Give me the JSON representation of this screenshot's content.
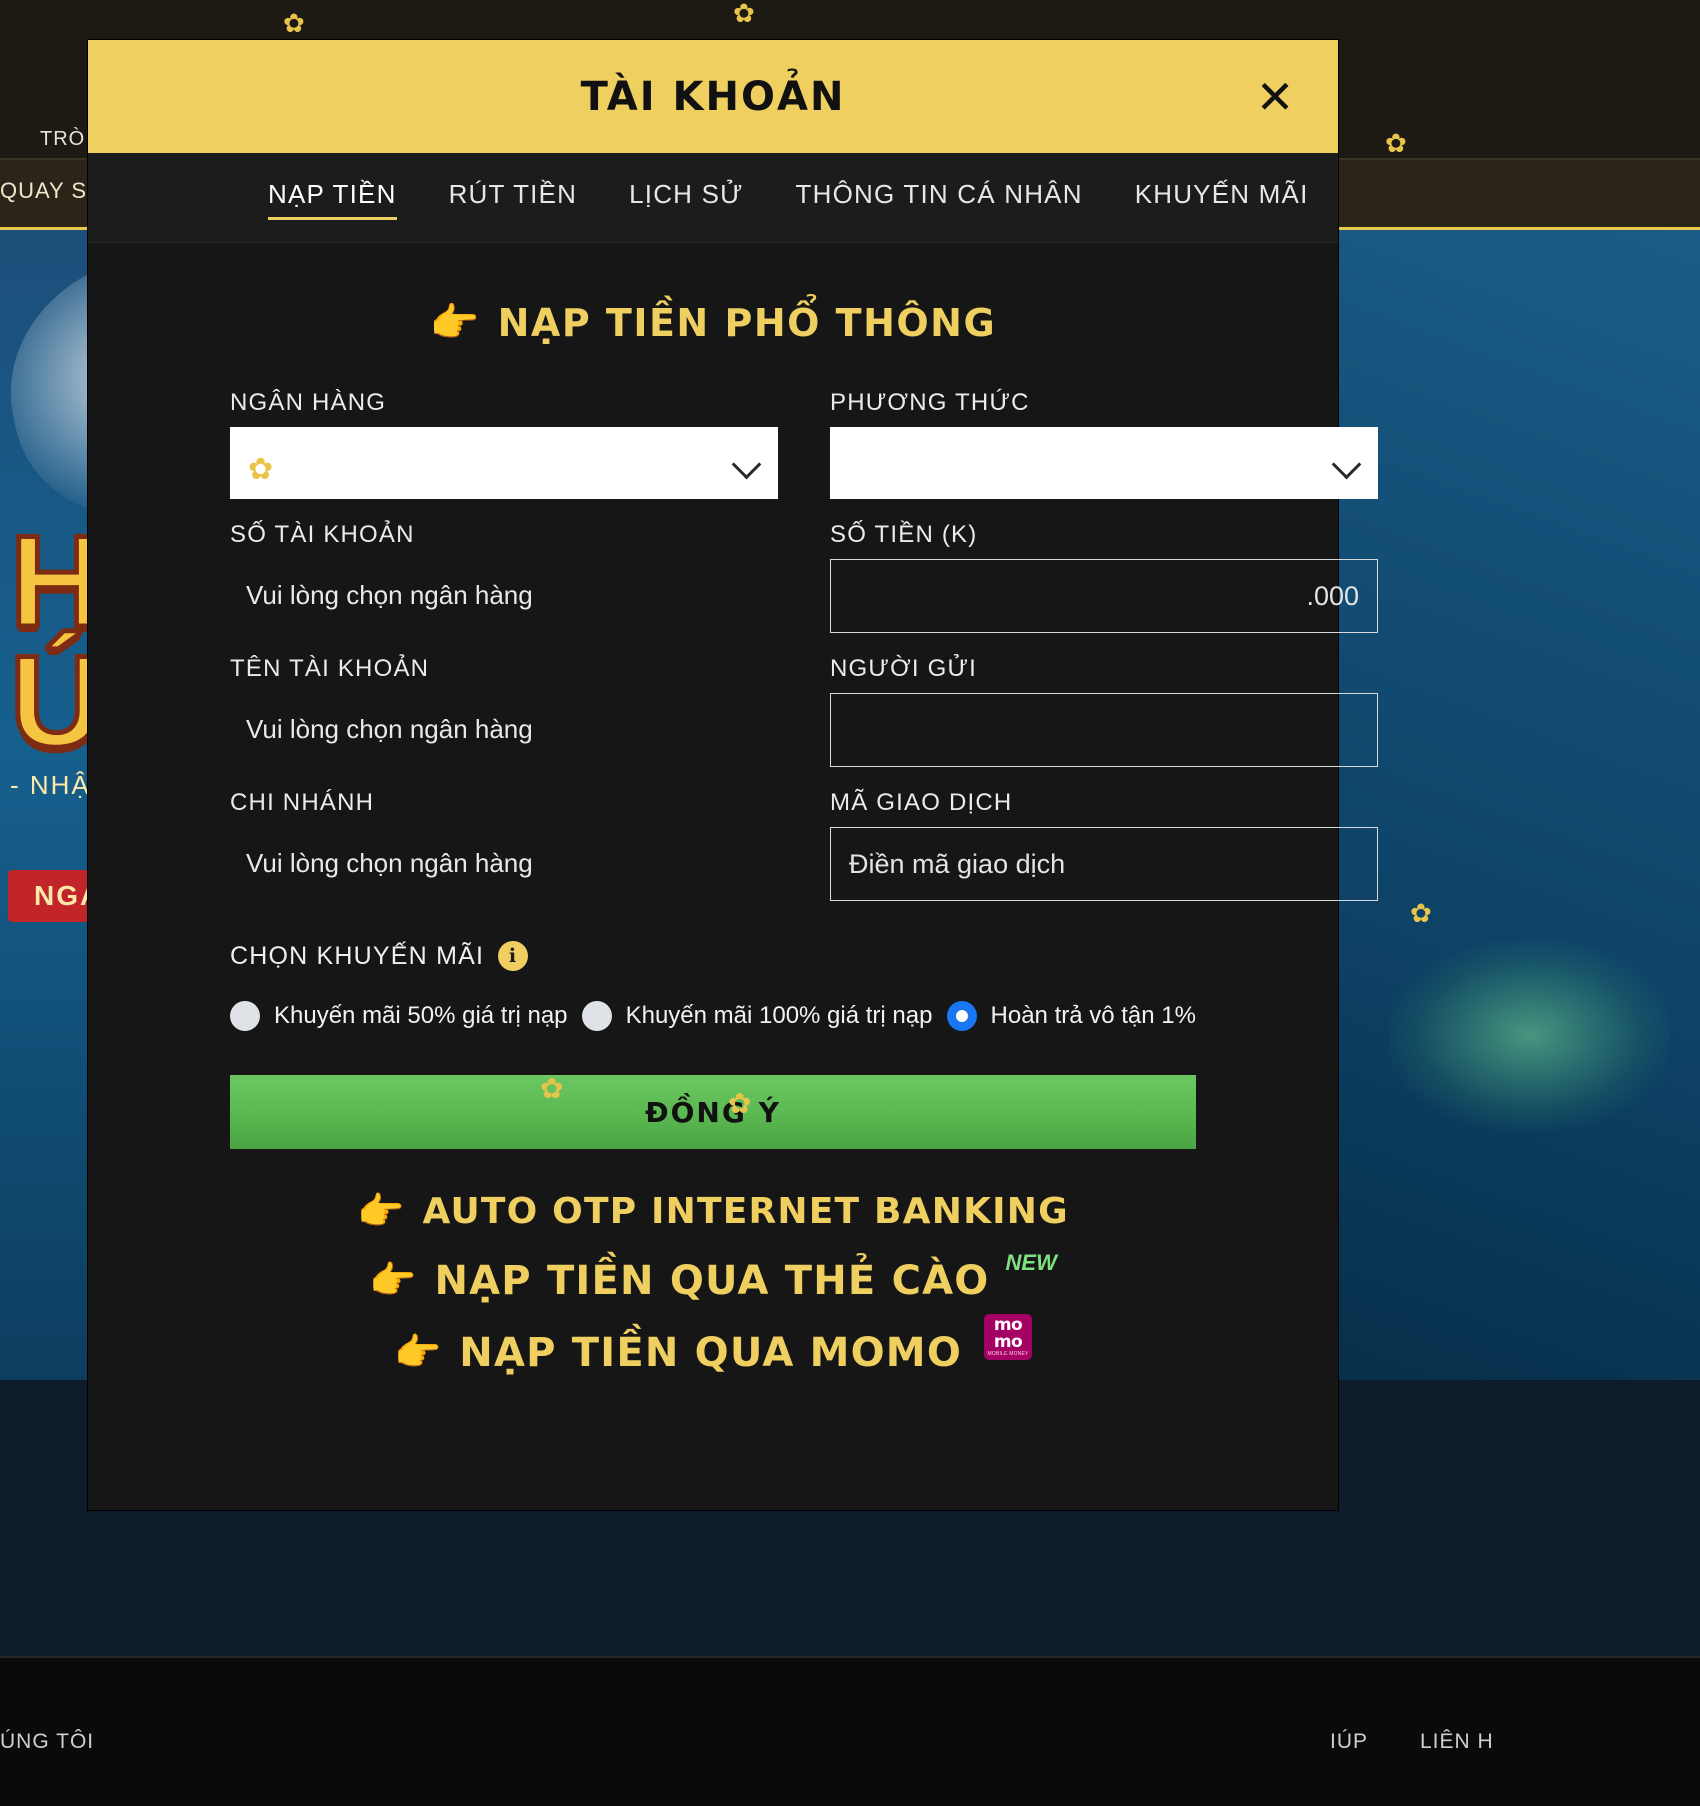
{
  "background": {
    "topbar_text": "TRÒ",
    "navbar_text": "QUAY SỐ",
    "hero_title_line1": "H",
    "hero_title_line2": "Ú",
    "hero_sub": "- NHẬN",
    "hero_cta": "NGAY",
    "footer_left": "ÚNG TÔI",
    "footer_mid": "IÚP",
    "footer_right": "LIÊN H"
  },
  "modal": {
    "title": "TÀI KHOẢN",
    "close_icon": "close-icon",
    "tabs": [
      {
        "label": "NẠP TIỀN",
        "active": true
      },
      {
        "label": "RÚT TIỀN",
        "active": false
      },
      {
        "label": "LỊCH SỬ",
        "active": false
      },
      {
        "label": "THÔNG TIN CÁ NHÂN",
        "active": false
      },
      {
        "label": "KHUYẾN MÃI",
        "active": false
      }
    ],
    "section": {
      "finger": "👉",
      "heading": "NẠP TIỀN PHỔ THÔNG"
    },
    "fields": {
      "bank_label": "NGÂN HÀNG",
      "bank_value": "",
      "method_label": "PHƯƠNG THỨC",
      "method_value": "",
      "account_number_label": "SỐ TÀI KHOẢN",
      "account_number_value": "Vui lòng chọn ngân hàng",
      "amount_label": "SỐ TIỀN (K)",
      "amount_value": "",
      "amount_suffix": ".000",
      "account_name_label": "TÊN TÀI KHOẢN",
      "account_name_value": "Vui lòng chọn ngân hàng",
      "sender_label": "NGƯỜI GỬI",
      "sender_value": "",
      "sender_placeholder": "",
      "branch_label": "CHI NHÁNH",
      "branch_value": "Vui lòng chọn ngân hàng",
      "transaction_code_label": "MÃ GIAO DỊCH",
      "transaction_code_value": "",
      "transaction_code_placeholder": "Điền mã giao dịch"
    },
    "promo": {
      "title": "CHỌN KHUYẾN MÃI",
      "info_icon": "info-icon",
      "options": [
        {
          "label": "Khuyến mãi 50% giá trị nạp",
          "selected": false
        },
        {
          "label": "Khuyến mãi 100% giá trị nạp",
          "selected": false
        },
        {
          "label": "Hoàn trả vô tận 1%",
          "selected": true
        }
      ]
    },
    "submit_label": "ĐỒNG Ý",
    "links": [
      {
        "finger": "👉",
        "text": "AUTO OTP INTERNET BANKING",
        "badge": ""
      },
      {
        "finger": "👉",
        "text": "NẠP TIỀN QUA THẺ CÀO",
        "badge": "NEW"
      },
      {
        "finger": "👉",
        "text": "NẠP TIỀN QUA MOMO",
        "badge": "momo"
      }
    ],
    "momo_logo": {
      "line1": "mo",
      "line2": "mo",
      "line3": "MOBILE MONEY"
    }
  },
  "colors": {
    "header_yellow": "#eecf5f",
    "accent_gold": "#eecf5f",
    "submit_green": "#5cba52",
    "radio_selected_blue": "#1877f2",
    "momo_pink": "#a50064",
    "new_green": "#7ee07e"
  }
}
